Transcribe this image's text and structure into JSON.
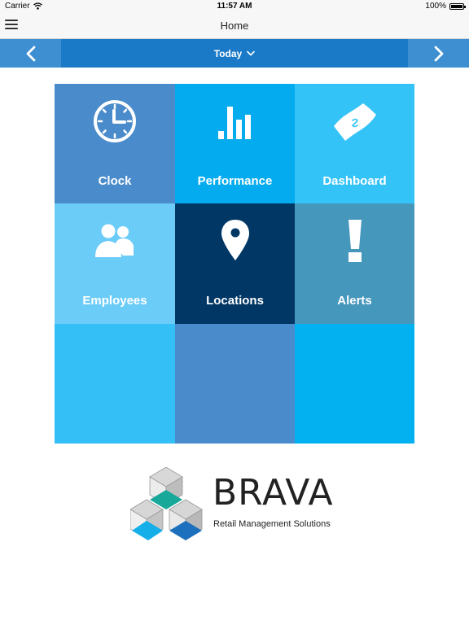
{
  "status_bar": {
    "carrier": "Carrier",
    "time": "11:57 AM",
    "battery": "100%"
  },
  "nav": {
    "title": "Home"
  },
  "date_nav": {
    "label": "Today"
  },
  "tiles": [
    {
      "label": "Clock",
      "color": "#4a8bcb",
      "icon": "clock-icon"
    },
    {
      "label": "Performance",
      "color": "#04abee",
      "icon": "bar-chart-icon"
    },
    {
      "label": "Dashboard",
      "color": "#34c3f7",
      "icon": "money-icon"
    },
    {
      "label": "Employees",
      "color": "#6cccf8",
      "icon": "users-icon"
    },
    {
      "label": "Locations",
      "color": "#003765",
      "icon": "location-pin-icon"
    },
    {
      "label": "Alerts",
      "color": "#4597bc",
      "icon": "exclamation-icon"
    },
    {
      "label": "",
      "color": "#34bff6"
    },
    {
      "label": "",
      "color": "#4a8bcb"
    },
    {
      "label": "",
      "color": "#04b1f0"
    }
  ],
  "logo": {
    "wordmark": "BRAVA",
    "tagline": "Retail Management Solutions"
  }
}
